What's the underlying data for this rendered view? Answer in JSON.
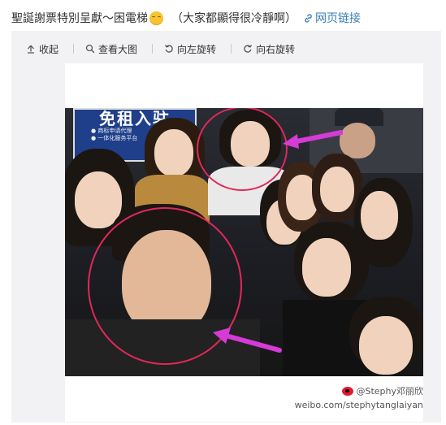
{
  "header": {
    "title": "聖誕謝票特別呈獻～困電梯",
    "emoji_icon": "relieved-face-icon",
    "note": "（大家都顯得很冷靜啊）",
    "link_label": "网页链接",
    "link_icon": "link-icon",
    "link_color": "#3b7fb8"
  },
  "toolbar": {
    "items": [
      {
        "label": "收起",
        "icon": "collapse-up-icon"
      },
      {
        "label": "查看大图",
        "icon": "search-icon"
      },
      {
        "label": "向左旋转",
        "icon": "rotate-left-icon"
      },
      {
        "label": "向右旋转",
        "icon": "rotate-right-icon"
      }
    ]
  },
  "photo": {
    "sign_text": "免租入驻",
    "watermark_user": "@Stephy邓丽欣",
    "watermark_url": "weibo.com/stephytanglaiyan",
    "highlight_color": "#e0285a"
  }
}
